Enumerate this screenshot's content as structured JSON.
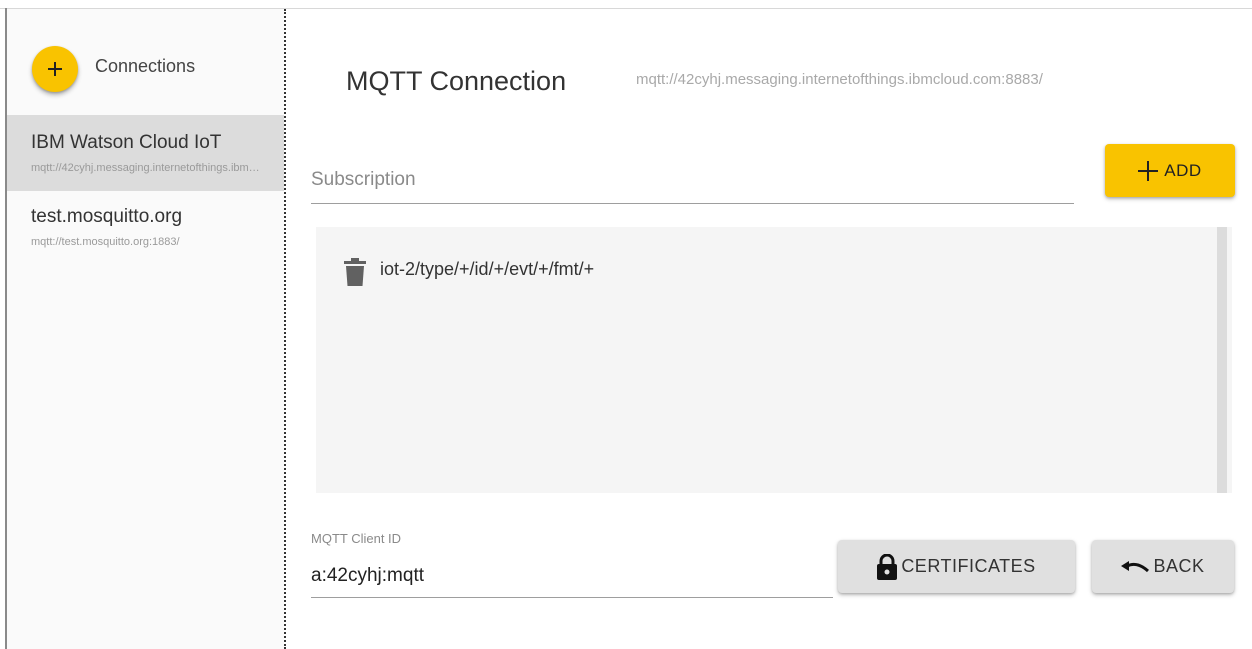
{
  "sidebar": {
    "title": "Connections",
    "add_button_icon": "plus-icon",
    "items": [
      {
        "name": "IBM Watson Cloud IoT",
        "url": "mqtt://42cyhj.messaging.internetofthings.ibmcloud.com:8883/",
        "selected": true
      },
      {
        "name": "test.mosquitto.org",
        "url": "mqtt://test.mosquitto.org:1883/",
        "selected": false
      }
    ]
  },
  "main": {
    "title": "MQTT Connection",
    "url": "mqtt://42cyhj.messaging.internetofthings.ibmcloud.com:8883/",
    "subscription": {
      "placeholder": "Subscription",
      "value": ""
    },
    "add_button": {
      "label": "ADD",
      "icon": "plus-icon"
    },
    "subscriptions": [
      {
        "topic": "iot-2/type/+/id/+/evt/+/fmt/+",
        "icon": "trash-icon"
      }
    ],
    "client_id": {
      "label": "MQTT Client ID",
      "value": "a:42cyhj:mqtt"
    },
    "certificates_button": {
      "label": "CERTIFICATES",
      "icon": "lock-icon"
    },
    "back_button": {
      "label": "BACK",
      "icon": "undo-icon"
    }
  },
  "colors": {
    "accent": "#f9c300",
    "selected_item": "#dcdcdc",
    "button_grey": "#e0e0e0"
  }
}
